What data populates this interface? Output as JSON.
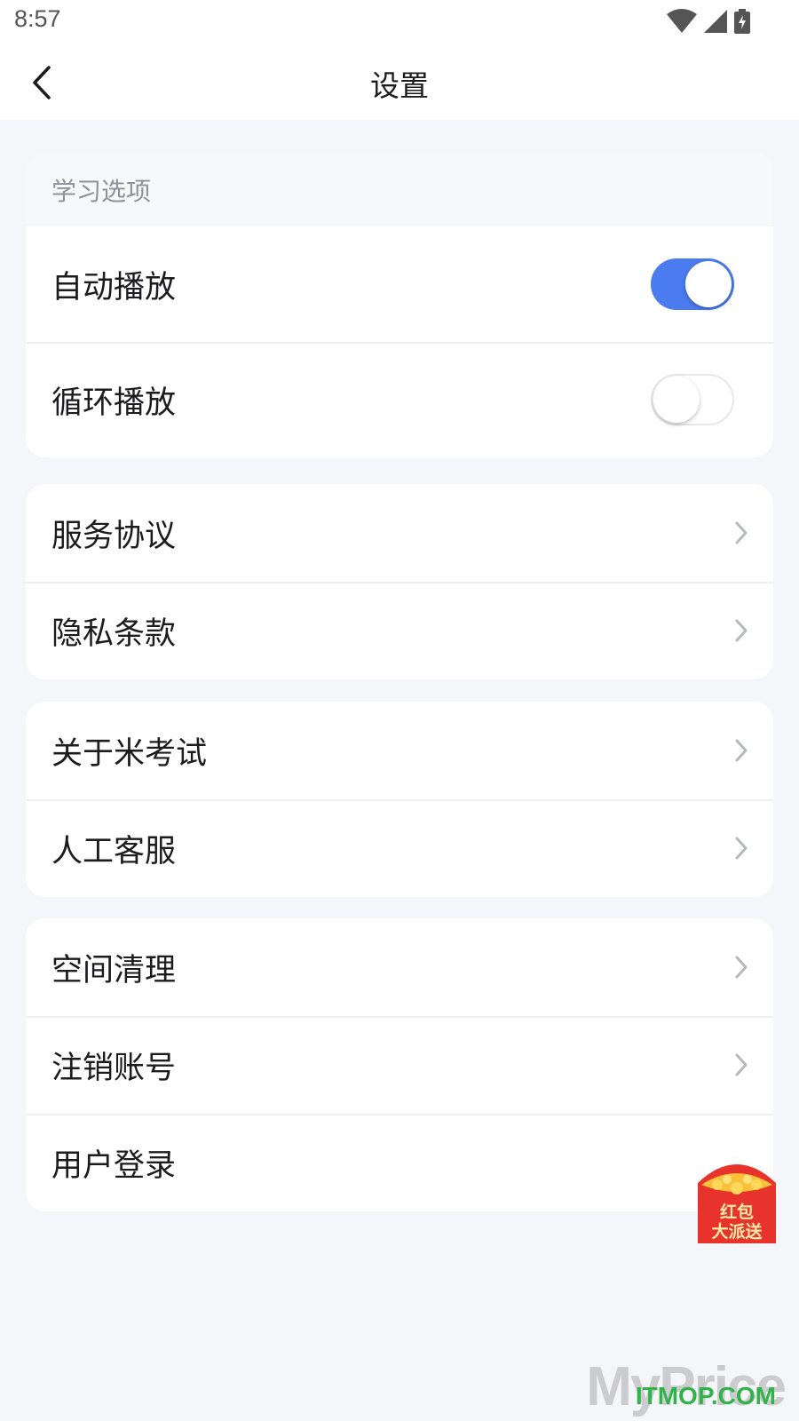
{
  "status_bar": {
    "time": "8:57",
    "icons": [
      "wifi-icon",
      "signal-icon",
      "battery-icon"
    ]
  },
  "nav": {
    "title": "设置"
  },
  "sections": {
    "learning": {
      "header": "学习选项",
      "autoplay": {
        "label": "自动播放",
        "enabled": true
      },
      "loop": {
        "label": "循环播放",
        "enabled": false
      }
    },
    "legal": {
      "service_agreement": "服务协议",
      "privacy_policy": "隐私条款"
    },
    "about": {
      "about_app": "关于米考试",
      "customer_service": "人工客服"
    },
    "account": {
      "clear_space": "空间清理",
      "cancel_account": "注销账号",
      "user_login": "用户登录"
    }
  },
  "promo": {
    "line1": "红包",
    "line2": "大派送"
  },
  "watermark": {
    "brand": "MyPrice",
    "site": "ITMOP.COM"
  },
  "colors": {
    "accent": "#4a7cf0",
    "background": "#f5f6fa",
    "promo_red": "#e8332d",
    "watermark_green": "#32b24a"
  }
}
